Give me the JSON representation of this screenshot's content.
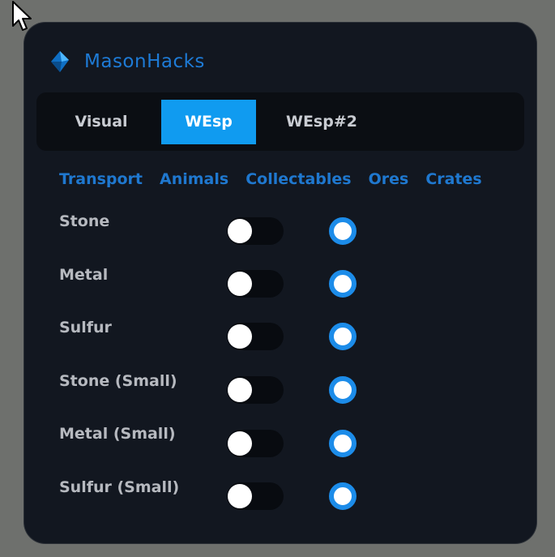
{
  "app": {
    "brand": "MasonHacks"
  },
  "tabs": [
    {
      "label": "Visual",
      "active": false
    },
    {
      "label": "WEsp",
      "active": true
    },
    {
      "label": "WEsp#2",
      "active": false
    }
  ],
  "subtabs": [
    {
      "label": "Transport"
    },
    {
      "label": "Animals"
    },
    {
      "label": "Collectables"
    },
    {
      "label": "Ores"
    },
    {
      "label": "Crates"
    }
  ],
  "rows": [
    {
      "label": "Stone",
      "toggle_on": false,
      "radio_selected": true
    },
    {
      "label": "Metal",
      "toggle_on": false,
      "radio_selected": true
    },
    {
      "label": "Sulfur",
      "toggle_on": false,
      "radio_selected": true
    },
    {
      "label": "Stone (Small)",
      "toggle_on": false,
      "radio_selected": true
    },
    {
      "label": "Metal (Small)",
      "toggle_on": false,
      "radio_selected": true
    },
    {
      "label": "Sulfur (Small)",
      "toggle_on": false,
      "radio_selected": true
    }
  ],
  "colors": {
    "accent": "#109bf0",
    "brand": "#1e7bd6",
    "panel_bg": "#121720",
    "tabbar_bg": "#0b0e13",
    "radio_ring": "#1c8ce9"
  },
  "icons": {
    "logo": "masonhacks-logo-icon",
    "cursor": "mouse-cursor-icon"
  }
}
